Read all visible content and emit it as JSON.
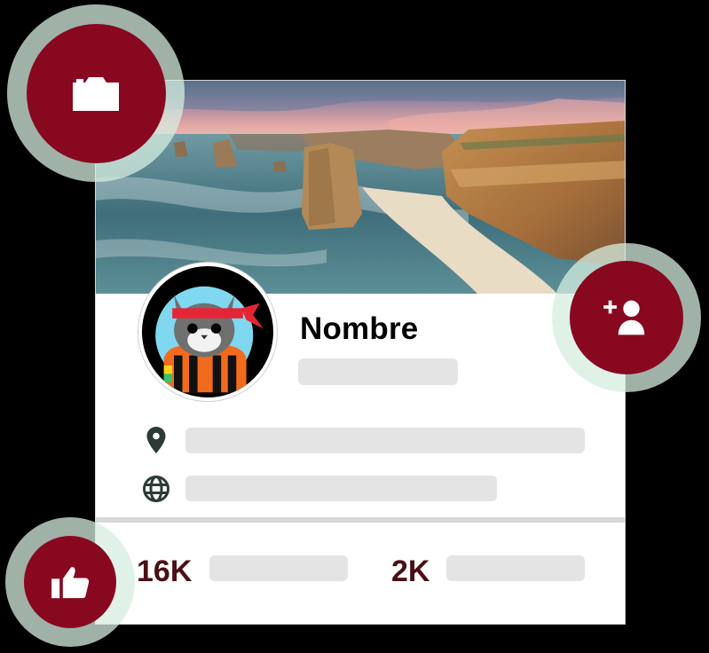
{
  "profile": {
    "name": "Nombre"
  },
  "stats": {
    "followers_value": "16K",
    "following_value": "2K"
  },
  "colors": {
    "accent": "#880820",
    "accent_text": "#4a0f16",
    "halo": "#d6eee0",
    "placeholder": "#e4e4e4"
  },
  "icons": {
    "camera": "camera-icon",
    "add_user": "add-user-icon",
    "like": "thumbs-up-icon",
    "location": "location-pin-icon",
    "website": "globe-icon"
  }
}
